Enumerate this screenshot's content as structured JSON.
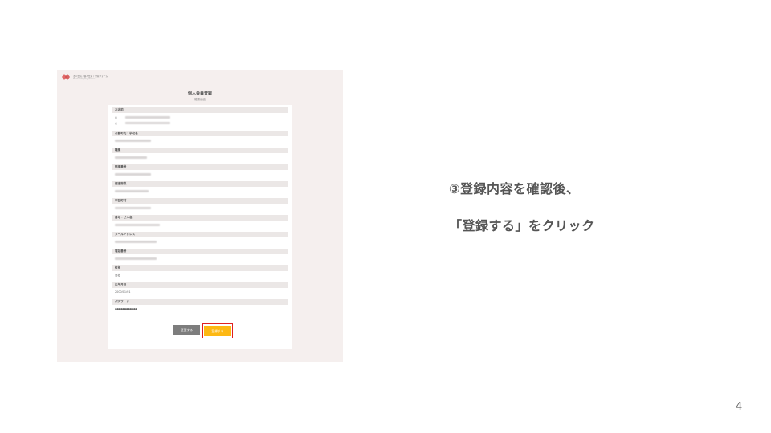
{
  "screenshot": {
    "logo": {
      "line1": "法人会員 / 個人会員 / 登録フォーム",
      "line2": "Membership Registration"
    },
    "form_title": "個人会員登録",
    "form_subtitle": "確認画面",
    "sections": [
      {
        "label": "お名前",
        "value": ""
      },
      {
        "label": "お勤め先・学校名",
        "value": ""
      },
      {
        "label": "職業",
        "value": ""
      },
      {
        "label": "郵便番号",
        "value": ""
      },
      {
        "label": "都道府県",
        "value": ""
      },
      {
        "label": "市区町村",
        "value": ""
      },
      {
        "label": "番地・ビル名",
        "value": ""
      },
      {
        "label": "メールアドレス",
        "value": ""
      },
      {
        "label": "電話番号",
        "value": ""
      },
      {
        "label": "性別",
        "value": "男性"
      },
      {
        "label": "生年月日",
        "value": "2000/01/01"
      },
      {
        "label": "パスワード",
        "value": "●●●●●●●●●●●●"
      }
    ],
    "name_sublabels": {
      "sei": "姓",
      "mei": "名"
    },
    "change_button": "変更する",
    "register_button": "登録する"
  },
  "instructions": {
    "line1": "③登録内容を確認後、",
    "line2": "「登録する」をクリック"
  },
  "page_number": "4",
  "colors": {
    "highlight": "#e02020",
    "register": "#fdb813",
    "change": "#7d7d7d",
    "frame_bg": "#f5efee"
  }
}
